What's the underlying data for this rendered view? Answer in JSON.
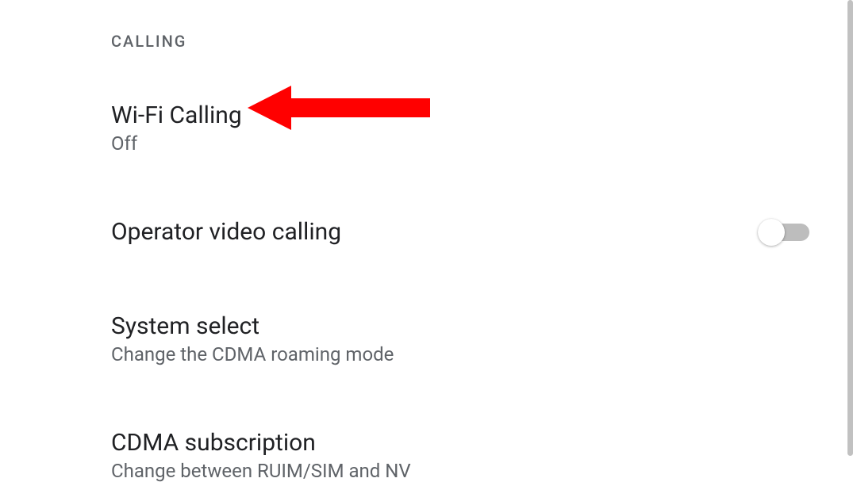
{
  "section": {
    "header": "CALLING"
  },
  "settings": {
    "wifi_calling": {
      "title": "Wi-Fi Calling",
      "subtitle": "Off"
    },
    "operator_video": {
      "title": "Operator video calling",
      "toggle_state": "off"
    },
    "system_select": {
      "title": "System select",
      "subtitle": "Change the CDMA roaming mode"
    },
    "cdma_subscription": {
      "title": "CDMA subscription",
      "subtitle": "Change between RUIM/SIM and NV"
    }
  },
  "annotation": {
    "color": "#ff0000"
  }
}
